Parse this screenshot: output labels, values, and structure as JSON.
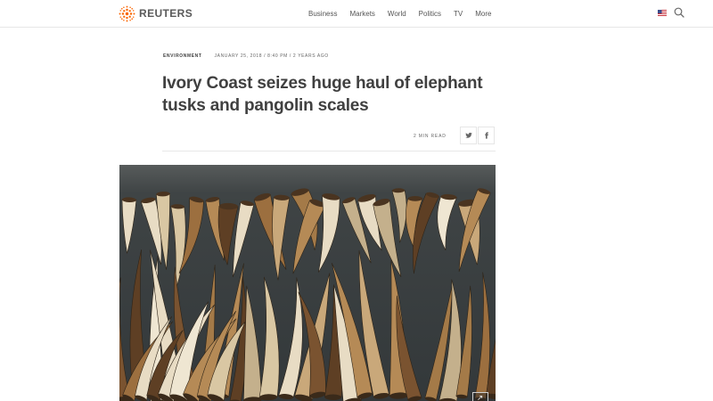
{
  "brand": {
    "name": "REUTERS",
    "accent": "#fa6400"
  },
  "nav": {
    "items": [
      {
        "label": "Business"
      },
      {
        "label": "Markets"
      },
      {
        "label": "World"
      },
      {
        "label": "Politics"
      },
      {
        "label": "TV"
      },
      {
        "label": "More"
      }
    ]
  },
  "header": {
    "flag_icon": "us-flag-icon",
    "search_icon": "search-icon"
  },
  "article": {
    "section": "Environment",
    "date": "January 25, 2018 / 8:40 PM / 2 years ago",
    "headline": "Ivory Coast seizes huge haul of elephant tusks and pangolin scales",
    "read_time": "2 Min Read",
    "share": {
      "twitter_icon": "twitter-icon",
      "facebook_icon": "facebook-icon"
    },
    "photo": {
      "subject_icon": "photo-elephant-tusks",
      "expand_icon": "expand-icon"
    }
  }
}
